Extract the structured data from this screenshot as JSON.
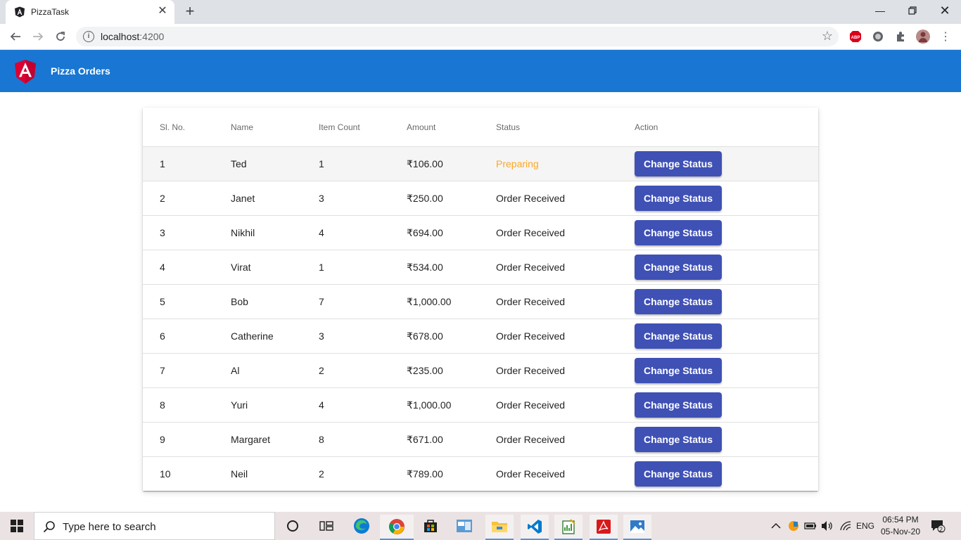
{
  "browser": {
    "tab_title": "PizzaTask",
    "url_host": "localhost",
    "url_port": ":4200"
  },
  "app": {
    "title": "Pizza Orders"
  },
  "table": {
    "headers": [
      "Sl. No.",
      "Name",
      "Item Count",
      "Amount",
      "Status",
      "Action"
    ],
    "action_label": "Change Status",
    "rows": [
      {
        "sl": "1",
        "name": "Ted",
        "count": "1",
        "amount": "₹106.00",
        "status": "Preparing"
      },
      {
        "sl": "2",
        "name": "Janet",
        "count": "3",
        "amount": "₹250.00",
        "status": "Order Received"
      },
      {
        "sl": "3",
        "name": "Nikhil",
        "count": "4",
        "amount": "₹694.00",
        "status": "Order Received"
      },
      {
        "sl": "4",
        "name": "Virat",
        "count": "1",
        "amount": "₹534.00",
        "status": "Order Received"
      },
      {
        "sl": "5",
        "name": "Bob",
        "count": "7",
        "amount": "₹1,000.00",
        "status": "Order Received"
      },
      {
        "sl": "6",
        "name": "Catherine",
        "count": "3",
        "amount": "₹678.00",
        "status": "Order Received"
      },
      {
        "sl": "7",
        "name": "Al",
        "count": "2",
        "amount": "₹235.00",
        "status": "Order Received"
      },
      {
        "sl": "8",
        "name": "Yuri",
        "count": "4",
        "amount": "₹1,000.00",
        "status": "Order Received"
      },
      {
        "sl": "9",
        "name": "Margaret",
        "count": "8",
        "amount": "₹671.00",
        "status": "Order Received"
      },
      {
        "sl": "10",
        "name": "Neil",
        "count": "2",
        "amount": "₹789.00",
        "status": "Order Received"
      }
    ]
  },
  "taskbar": {
    "search_placeholder": "Type here to search",
    "language": "ENG",
    "time": "06:54 PM",
    "date": "05-Nov-20",
    "notification_count": "2"
  },
  "colors": {
    "header": "#1976d2",
    "button": "#3f51b5",
    "preparing": "#f9a825"
  }
}
